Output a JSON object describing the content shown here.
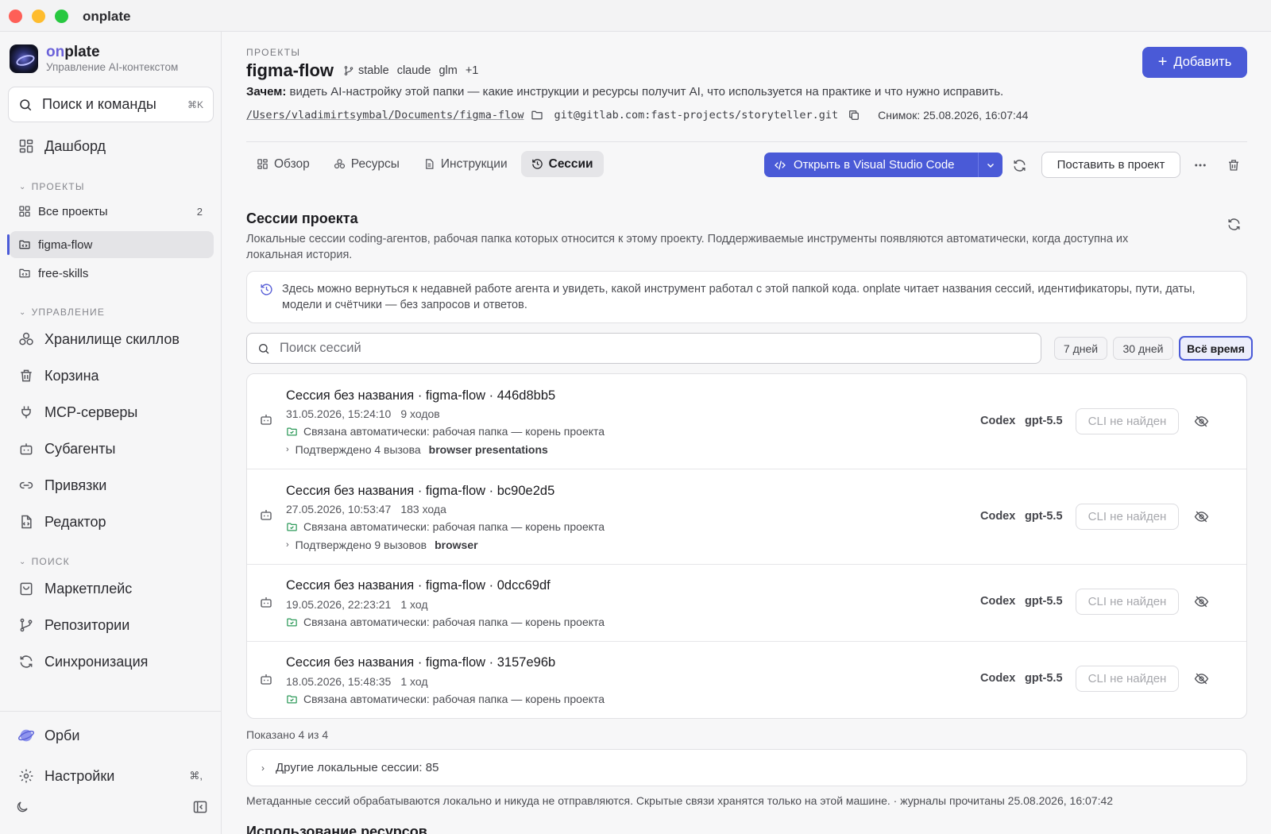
{
  "window": {
    "title": "onplate"
  },
  "brand": {
    "name_prefix": "on",
    "name_suffix": "plate",
    "subtitle": "Управление AI-контекстом"
  },
  "sidebar": {
    "search_placeholder": "Поиск и команды",
    "search_shortcut": "⌘K",
    "dashboard": "Дашборд",
    "projects_header": "ПРОЕКТЫ",
    "all_projects": "Все проекты",
    "all_projects_count": "2",
    "project_1": "figma-flow",
    "project_2": "free-skills",
    "manage_header": "УПРАВЛЕНИЕ",
    "skills": "Хранилище скиллов",
    "trash": "Корзина",
    "mcp": "MCP-серверы",
    "subagents": "Субагенты",
    "bindings": "Привязки",
    "editor": "Редактор",
    "search_header": "ПОИСК",
    "marketplace": "Маркетплейс",
    "repos": "Репозитории",
    "sync": "Синхронизация",
    "orbi": "Орби",
    "settings": "Настройки",
    "settings_shortcut": "⌘,"
  },
  "header": {
    "breadcrumb": "ПРОЕКТЫ",
    "title": "figma-flow",
    "branch": "stable",
    "tag_1": "claude",
    "tag_2": "glm",
    "tag_more": "+1",
    "why_label": "Зачем:",
    "why_text": " видеть AI-настройку этой папки — какие инструкции и ресурсы получит AI, что используется на практике и что нужно исправить.",
    "path": "/Users/vladimirtsymbal/Documents/figma-flow",
    "git": "git@gitlab.com:fast-projects/storyteller.git",
    "snapshot": "Снимок: 25.08.2026, 16:07:44",
    "add_button": "Добавить"
  },
  "tabs": {
    "overview": "Обзор",
    "resources": "Ресурсы",
    "instructions": "Инструкции",
    "sessions": "Сессии"
  },
  "toolbar": {
    "open_vscode": "Открыть в Visual Studio Code",
    "put_in_project": "Поставить в проект"
  },
  "sessions": {
    "title": "Сессии проекта",
    "description": "Локальные сессии coding-агентов, рабочая папка которых относится к этому проекту. Поддерживаемые инструменты появляются автоматически, когда доступна их локальная история.",
    "info": "Здесь можно вернуться к недавней работе агента и увидеть, какой инструмент работал с этой папкой кода. onplate читает названия сессий, идентификаторы, пути, даты, модели и счётчики — без запросов и ответов.",
    "search_placeholder": "Поиск сессий",
    "filter_7": "7 дней",
    "filter_30": "30 дней",
    "filter_all": "Всё время",
    "items": [
      {
        "title": "Сессия без названия · figma-flow · 446d8bb5",
        "date": "31.05.2026, 15:24:10",
        "turns": "9 ходов",
        "link": "Связана автоматически: рабочая папка — корень проекта",
        "confirmed": "Подтверждено 4 вызова",
        "tools": "browser  presentations",
        "agent": "Codex",
        "model": "gpt-5.5",
        "cli": "CLI не найден"
      },
      {
        "title": "Сессия без названия · figma-flow · bc90e2d5",
        "date": "27.05.2026, 10:53:47",
        "turns": "183 хода",
        "link": "Связана автоматически: рабочая папка — корень проекта",
        "confirmed": "Подтверждено 9 вызовов",
        "tools": "browser",
        "agent": "Codex",
        "model": "gpt-5.5",
        "cli": "CLI не найден"
      },
      {
        "title": "Сессия без названия · figma-flow · 0dcc69df",
        "date": "19.05.2026, 22:23:21",
        "turns": "1 ход",
        "link": "Связана автоматически: рабочая папка — корень проекта",
        "agent": "Codex",
        "model": "gpt-5.5",
        "cli": "CLI не найден"
      },
      {
        "title": "Сессия без названия · figma-flow · 3157e96b",
        "date": "18.05.2026, 15:48:35",
        "turns": "1 ход",
        "link": "Связана автоматически: рабочая папка — корень проекта",
        "agent": "Codex",
        "model": "gpt-5.5",
        "cli": "CLI не найден"
      }
    ],
    "shown": "Показано 4 из 4",
    "other_local": "Другие локальные сессии: 85",
    "footer": "Метаданные сессий обрабатываются локально и никуда не отправляются. Скрытые связи хранятся только на этой машине. · журналы прочитаны 25.08.2026, 16:07:42"
  },
  "next_section": "Использование ресурсов",
  "colors": {
    "accent": "#4a5ad7",
    "link_green": "#2e9a5a"
  }
}
